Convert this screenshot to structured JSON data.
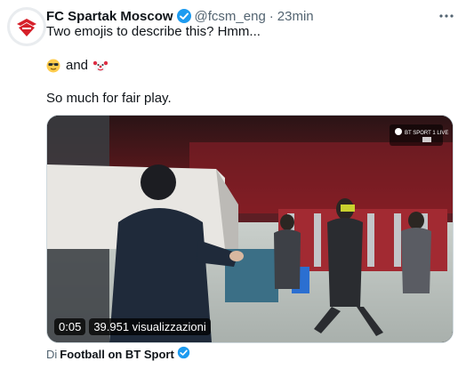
{
  "tweet": {
    "author_name": "FC Spartak Moscow",
    "handle": "@fcsm_eng",
    "separator": "·",
    "time": "23min",
    "line1": "Two emojis to describe this? Hmm...",
    "line2_and": "and",
    "line3": "So much for fair play."
  },
  "media": {
    "duration": "0:05",
    "views": "39.951 visualizzazioni",
    "broadcaster_logo_text": "BT SPORT 1 LIVE"
  },
  "source": {
    "prefix": "Di",
    "name": "Football on BT Sport"
  },
  "icons": {
    "verified": "verified-badge-icon",
    "more": "more-options-icon",
    "emoji1": "sunglasses-emoji-icon",
    "emoji2": "clown-emoji-icon"
  },
  "colors": {
    "brand_blue": "#1d9bf0",
    "spartak_red": "#d6202a",
    "text_primary": "#0f1419",
    "text_secondary": "#536471"
  }
}
